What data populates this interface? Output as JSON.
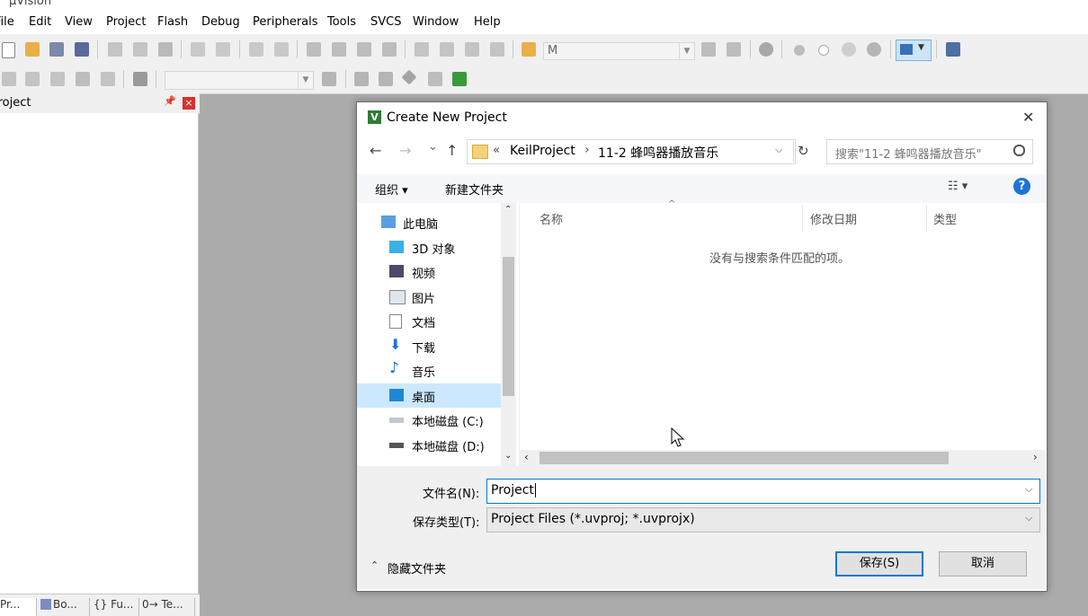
{
  "app": {
    "title": "µVision"
  },
  "menu": [
    "File",
    "Edit",
    "View",
    "Project",
    "Flash",
    "Debug",
    "Peripherals",
    "Tools",
    "SVCS",
    "Window",
    "Help"
  ],
  "toolbar": {
    "target_combo_value": "M"
  },
  "project_pane": {
    "title": "Project",
    "pin_glyph": "📌",
    "close_glyph": "×",
    "tabs": [
      "Pr...",
      "Bo...",
      "{} Fu...",
      "0→ Te..."
    ]
  },
  "dialog": {
    "title": "Create New Project",
    "close_glyph": "✕",
    "nav": {
      "back": "←",
      "forward": "→",
      "recent": "⌄",
      "up": "↑",
      "refresh": "↻"
    },
    "breadcrumb": {
      "overflow": "«",
      "parts": [
        "KeilProject",
        "11-2 蜂鸣器播放音乐"
      ],
      "sep": "›"
    },
    "search": {
      "placeholder": "搜索\"11-2 蜂鸣器播放音乐\""
    },
    "command_bar": {
      "organize": "组织 ▾",
      "new_folder": "新建文件夹",
      "view_glyph": "☷ ▾",
      "help_glyph": "?"
    },
    "tree": [
      {
        "label": "此电脑",
        "icon": "computer-icon",
        "level": 0
      },
      {
        "label": "3D 对象",
        "icon": "3d-objects-icon",
        "level": 1
      },
      {
        "label": "视频",
        "icon": "videos-icon",
        "level": 1
      },
      {
        "label": "图片",
        "icon": "pictures-icon",
        "level": 1
      },
      {
        "label": "文档",
        "icon": "documents-icon",
        "level": 1
      },
      {
        "label": "下载",
        "icon": "downloads-icon",
        "level": 1
      },
      {
        "label": "音乐",
        "icon": "music-icon",
        "level": 1
      },
      {
        "label": "桌面",
        "icon": "desktop-icon",
        "level": 1,
        "selected": true
      },
      {
        "label": "本地磁盘 (C:)",
        "icon": "drive-c-icon",
        "level": 1
      },
      {
        "label": "本地磁盘 (D:)",
        "icon": "drive-d-icon",
        "level": 1
      }
    ],
    "columns": [
      "名称",
      "修改日期",
      "类型"
    ],
    "empty_message": "没有与搜索条件匹配的项。",
    "filename": {
      "label": "文件名(N):",
      "value": "Project"
    },
    "filetype": {
      "label": "保存类型(T):",
      "value": "Project Files (*.uvproj; *.uvprojx)"
    },
    "hide_folders": "隐藏文件夹",
    "save_button": "保存(S)",
    "cancel_button": "取消"
  },
  "colors": {
    "accent": "#0078d7",
    "selected_tree": "#cce8ff",
    "help_blue": "#1e73d6"
  }
}
